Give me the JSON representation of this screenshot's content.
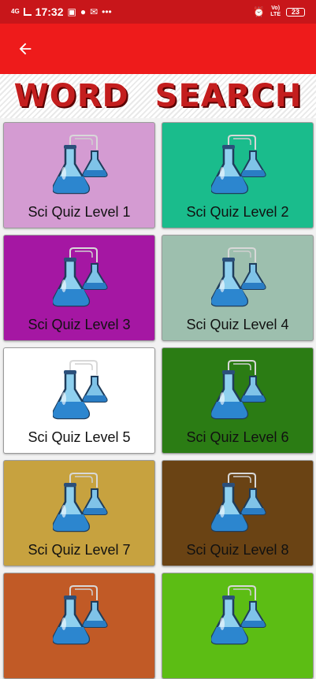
{
  "status_bar": {
    "network": "4G",
    "time": "17:32",
    "volte": "Vo)",
    "lte": "LTE",
    "battery": "23"
  },
  "app_bar": {
    "back_icon": "arrow-left-icon"
  },
  "banner": {
    "title": "WORD SEARCH"
  },
  "levels": [
    {
      "label": "Sci Quiz Level 1",
      "color": "#d49bd2"
    },
    {
      "label": "Sci Quiz Level 2",
      "color": "#1abc8c"
    },
    {
      "label": "Sci Quiz Level 3",
      "color": "#a517a3"
    },
    {
      "label": "Sci Quiz Level 4",
      "color": "#9dbfae"
    },
    {
      "label": "Sci Quiz Level 5",
      "color": "#ffffff"
    },
    {
      "label": "Sci Quiz Level 6",
      "color": "#2b7c14"
    },
    {
      "label": "Sci Quiz Level 7",
      "color": "#c7a23f"
    },
    {
      "label": "Sci Quiz Level 8",
      "color": "#6a4314"
    },
    {
      "label": "",
      "color": "#c15a26"
    },
    {
      "label": "",
      "color": "#5cbd14"
    }
  ],
  "colors": {
    "status_bar": "#c8161a",
    "app_bar": "#ee1b1b",
    "title": "#c41e1e"
  },
  "icons": {
    "card_icon": "flask-icon"
  }
}
